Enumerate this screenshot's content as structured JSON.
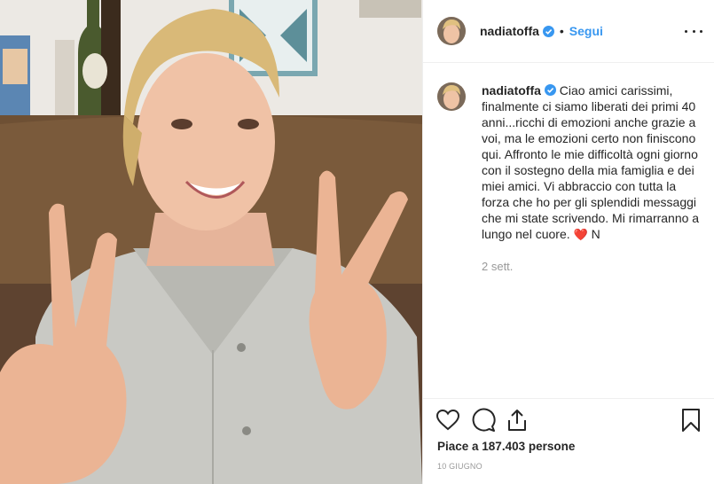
{
  "post": {
    "username": "nadiatoffa",
    "follow_label": "Segui",
    "separator": "•",
    "caption_username": "nadiatoffa",
    "caption_text": "Ciao amici carissimi, finalmente ci siamo liberati dei primi 40 anni...ricchi di emozioni anche grazie a voi, ma le emozioni certo non finiscono qui. Affronto le mie difficoltà ogni giorno con il sostegno della mia famiglia e dei miei amici. Vi abbraccio con tutta la forza che ho per gli splendidi messaggi che mi state scrivendo. Mi rimarranno a lungo nel cuore.",
    "caption_heart": "❤️",
    "caption_signoff": "N",
    "time_ago": "2 sett.",
    "likes": "Piace a 187.403 persone",
    "date": "10 GIUGNO"
  },
  "icons": {
    "verified": "verified-badge-icon",
    "more": "more-options-icon",
    "like": "heart-icon",
    "comment": "comment-icon",
    "share": "share-icon",
    "save": "bookmark-icon"
  },
  "colors": {
    "link_blue": "#3897f0",
    "verified_blue": "#3897f0",
    "text": "#262626",
    "muted": "#999999",
    "heart_red": "#ed4956"
  }
}
